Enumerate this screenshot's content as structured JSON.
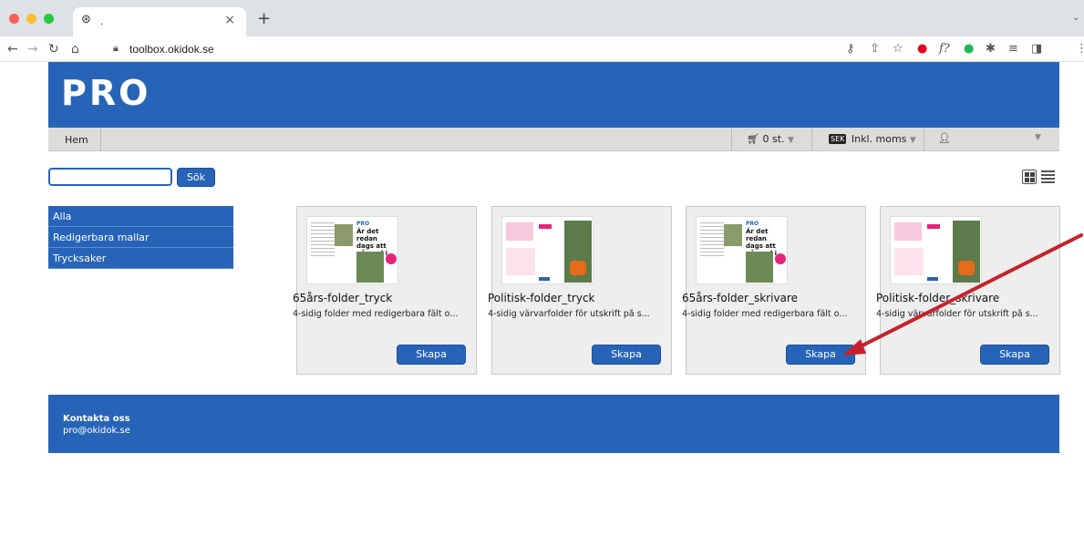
{
  "browser": {
    "tab_title": ".",
    "tab_close": "×",
    "new_tab": "+",
    "url": "toolbox.okidok.se"
  },
  "header": {
    "logo_text": "PRO"
  },
  "nav": {
    "home": "Hem",
    "cart": "0 st.",
    "currency_badge": "SEK",
    "currency": "Inkl. moms"
  },
  "search": {
    "button_label": "Sök",
    "value": ""
  },
  "sidebar": {
    "items": [
      {
        "label": "Alla"
      },
      {
        "label": "Redigerbara mallar"
      },
      {
        "label": "Trycksaker"
      }
    ]
  },
  "products": [
    {
      "title": "65års-folder_tryck",
      "description": "4-sidig folder med redigerbara fält o...",
      "button": "Skapa",
      "thumb_heading": "Är det redan dags att gå med i PRO?"
    },
    {
      "title": "Politisk-folder_tryck",
      "description": "4-sidig värvarfolder för utskrift på s...",
      "button": "Skapa"
    },
    {
      "title": "65års-folder_skrivare",
      "description": "4-sidig folder med redigerbara fält o...",
      "button": "Skapa",
      "thumb_heading": "Är det redan dags att gå med i PRO?"
    },
    {
      "title": "Politisk-folder_skrivare",
      "description": "4-sidig värvarfolder för utskrift på s...",
      "button": "Skapa"
    }
  ],
  "footer": {
    "title": "Kontakta oss",
    "email": "pro@okidok.se"
  },
  "colors": {
    "brand_blue": "#2764b8",
    "annotation_red": "#c8202a"
  }
}
